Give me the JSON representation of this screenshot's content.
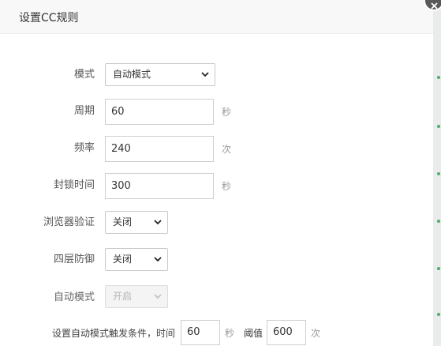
{
  "dialog": {
    "title": "设置CC规则"
  },
  "form": {
    "mode": {
      "label": "模式",
      "value": "自动模式"
    },
    "period": {
      "label": "周期",
      "value": "60",
      "unit": "秒"
    },
    "frequency": {
      "label": "频率",
      "value": "240",
      "unit": "次"
    },
    "block_time": {
      "label": "封锁时间",
      "value": "300",
      "unit": "秒"
    },
    "browser_verify": {
      "label": "浏览器验证",
      "value": "关闭"
    },
    "layer4_defense": {
      "label": "四层防御",
      "value": "关闭"
    },
    "auto_mode": {
      "label": "自动模式",
      "value": "开启"
    },
    "auto_trigger": {
      "prefix": "设置自动模式触发条件，时间",
      "time_value": "60",
      "time_unit": "秒",
      "threshold_label": "阈值",
      "threshold_value": "600",
      "threshold_unit": "次"
    }
  }
}
